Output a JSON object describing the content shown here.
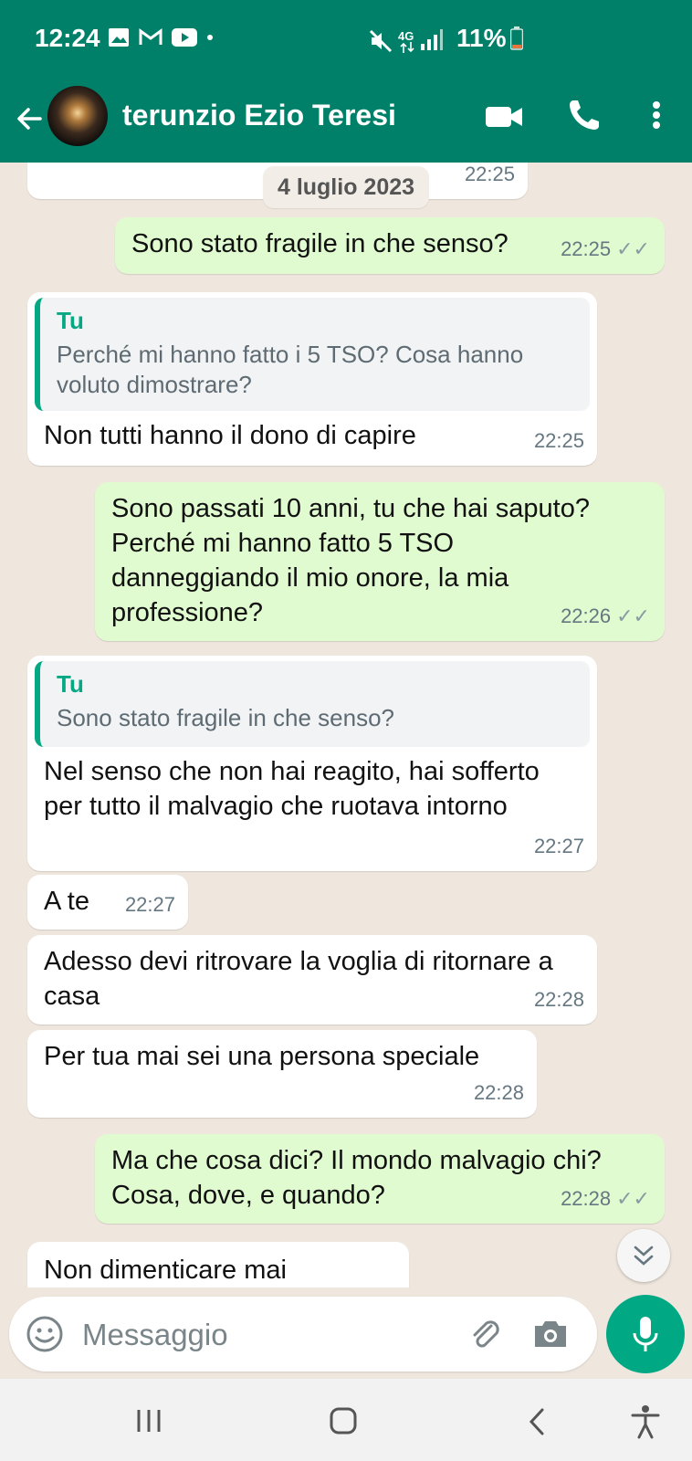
{
  "status_bar": {
    "time": "12:24",
    "network": "4G",
    "battery": "11%"
  },
  "header": {
    "contact_name": "terunzio Ezio Teresi",
    "back_icon": "arrow-left-icon",
    "video_icon": "video-call-icon",
    "call_icon": "phone-icon",
    "menu_icon": "more-vert-icon"
  },
  "chat": {
    "date_chip": "4 luglio 2023",
    "partial_top_time": "22:25",
    "messages": [
      {
        "dir": "out",
        "text": "Sono stato fragile in che senso?",
        "time": "22:25"
      },
      {
        "dir": "in",
        "quote_author": "Tu",
        "quote_text": "Perché mi hanno fatto i 5 TSO? Cosa hanno voluto dimostrare?",
        "text": "Non tutti hanno il dono di capire",
        "time": "22:25"
      },
      {
        "dir": "out",
        "text": "Sono passati 10 anni, tu che hai saputo? Perché mi hanno fatto 5 TSO danneggiando il mio onore, la mia professione?",
        "time": "22:26"
      },
      {
        "dir": "in",
        "quote_author": "Tu",
        "quote_text": "Sono stato fragile in che senso?",
        "text": "Nel senso che non hai reagito, hai sofferto per tutto il malvagio che ruotava intorno",
        "time": "22:27"
      },
      {
        "dir": "in",
        "text": "A te",
        "time": "22:27"
      },
      {
        "dir": "in",
        "text": "Adesso devi ritrovare la voglia di ritornare a casa",
        "time": "22:28"
      },
      {
        "dir": "in",
        "text": "Per tua mai sei una persona speciale",
        "time": "22:28"
      },
      {
        "dir": "out",
        "text": "Ma che cosa dici? Il mondo malvagio chi? Cosa, dove, e quando?",
        "time": "22:28"
      },
      {
        "dir": "in",
        "text": "Non dimenticare mai",
        "time": ""
      }
    ]
  },
  "input": {
    "placeholder": "Messaggio"
  },
  "colors": {
    "header": "#008069",
    "outgoing_bubble": "#e1fbd0",
    "incoming_bubble": "#ffffff",
    "accent": "#00a884",
    "chat_background": "#efe7de"
  }
}
